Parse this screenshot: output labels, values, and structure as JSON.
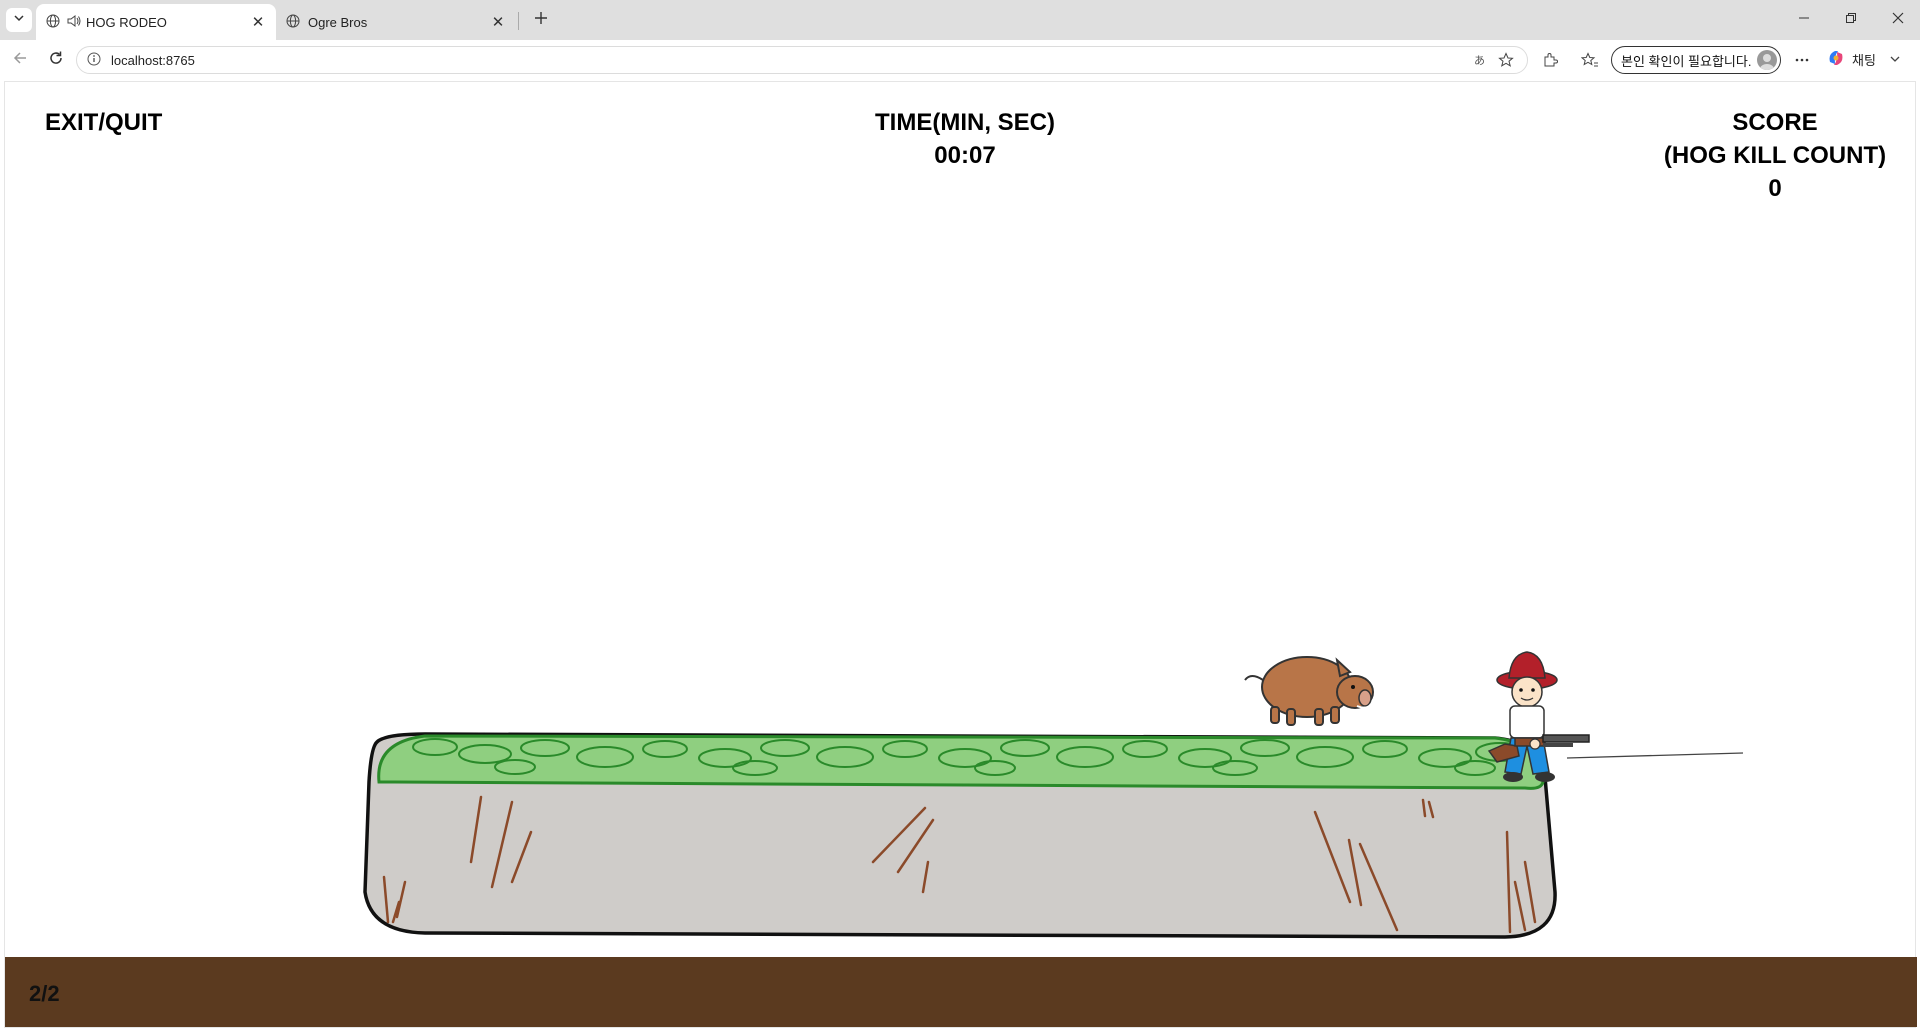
{
  "browser": {
    "tabs": [
      {
        "title": "HOG RODEO",
        "active": true,
        "audio": true
      },
      {
        "title": "Ogre Bros",
        "active": false
      }
    ],
    "address_url": "localhost:8765",
    "profile_label": "본인 확인이 필요합니다.",
    "copilot_label": "채팅"
  },
  "game": {
    "exit_label": "EXIT/QUIT",
    "time_title": "TIME(MIN, SEC)",
    "time_value": "00:07",
    "score_title": "SCORE",
    "score_subtitle": "(HOG KILL COUNT)",
    "score_value": "0",
    "level_indicator": "2/2",
    "colors": {
      "ground": "#5b3a1f",
      "rock": "#cfccc9",
      "grass": "#8fcf80",
      "grass_outline": "#2a8a2a",
      "hog": "#b87548",
      "cowboy_hat": "#b3202a",
      "jeans": "#1e8fe0"
    }
  }
}
